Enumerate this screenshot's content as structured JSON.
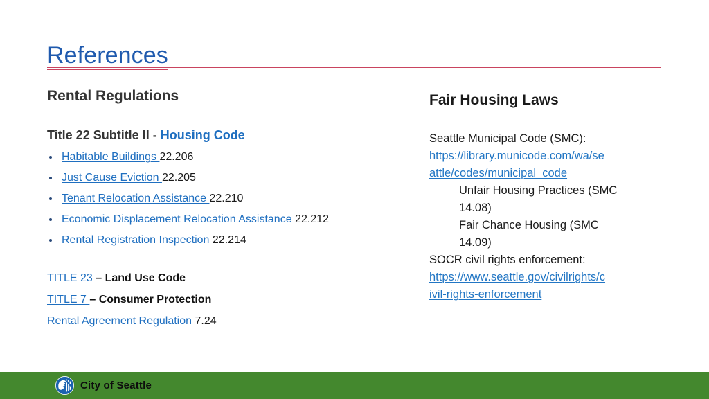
{
  "slide": {
    "title": "References",
    "accent_rule_color": "#C9445F",
    "title_color": "#1F5AAE",
    "link_color": "#1F6FC0",
    "footer_color": "#44882E"
  },
  "left_column": {
    "heading": "Rental Regulations",
    "subhead_prefix": "Title 22 Subtitle II - ",
    "subhead_link": "Housing Code",
    "bullets": [
      {
        "link": "Habitable Buildings ",
        "code": "22.206"
      },
      {
        "link": "Just Cause Eviction ",
        "code": "22.205"
      },
      {
        "link": "Tenant Relocation Assistance ",
        "code": "22.210"
      },
      {
        "link": "Economic Displacement Relocation Assistance ",
        "code": "22.212"
      },
      {
        "link": "Rental Registration Inspection ",
        "code": "22.214"
      }
    ],
    "refs": [
      {
        "link": "TITLE 23 ",
        "text": "– Land Use Code",
        "bold": true
      },
      {
        "link": "TITLE 7 ",
        "text": "– Consumer Protection",
        "bold": true
      },
      {
        "link": "Rental Agreement Regulation ",
        "text": "7.24",
        "bold": false
      }
    ]
  },
  "right_column": {
    "heading": "Fair Housing Laws",
    "smc_label": "Seattle Municipal Code (SMC):",
    "smc_url_line1": "https://library.municode.com/wa/se",
    "smc_url_line2": "attle/codes/municipal_code",
    "smc_items": [
      "Unfair Housing Practices (SMC",
      "14.08)",
      "Fair Chance Housing (SMC",
      "14.09)"
    ],
    "socr_label": "SOCR civil rights enforcement:",
    "socr_url_line1": "https://www.seattle.gov/civilrights/c",
    "socr_url_line2": "ivil-rights-enforcement"
  },
  "footer": {
    "label": "City of Seattle"
  }
}
